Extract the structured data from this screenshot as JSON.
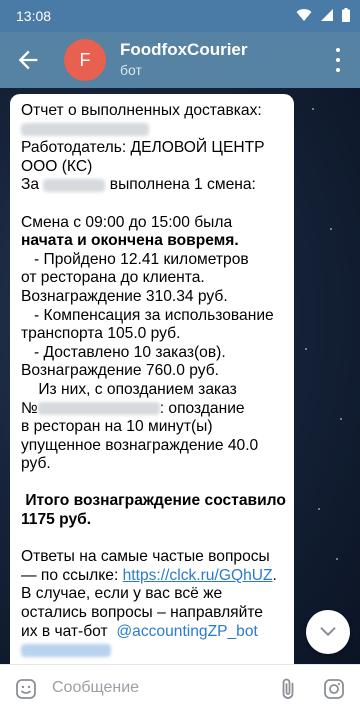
{
  "status_bar": {
    "time": "13:08"
  },
  "header": {
    "title": "FoodfoxCourier",
    "subtitle": "бот",
    "avatar_letter": "F",
    "avatar_color": "#e86150"
  },
  "message": {
    "l1": "Отчет о выполненных доставках:",
    "l3": "Работодатель: ДЕЛОВОЙ ЦЕНТР",
    "l4": "ООО (КС)",
    "l5a": "За",
    "l5b": "выполнена 1 смена:",
    "l7": "Смена с 09:00 до 15:00 была",
    "l8": "начата и окончена вовремя.",
    "l9": "   - Пройдено 12.41 километров",
    "l10": "от ресторана до клиента.",
    "l11": "Вознаграждение 310.34 руб.",
    "l12": "   - Компенсация за использование",
    "l13": "транспорта 105.0 руб.",
    "l14": "   - Доставлено 10 заказ(ов).",
    "l15": "Вознаграждение 760.0 руб.",
    "l16": "    Из них, с опозданием заказ",
    "l17a": "№",
    "l17b": ": опоздание",
    "l18": "в ресторан на 10 минут(ы)",
    "l19": "упущенное вознаграждение 40.0",
    "l20": "руб.",
    "l22": " Итого вознаграждение составило",
    "l23": "1175 руб.",
    "l25": "Ответы на самые частые вопросы",
    "l26a": "— по ссылке: ",
    "l26b": "https://clck.ru/GQhUZ",
    "l26c": ".",
    "l27": "В случае, если у вас всё же",
    "l28": "остались вопросы – направляйте",
    "l29a": "их в чат-бот  ",
    "l29b": "@accountingZP_bot"
  },
  "input": {
    "placeholder": "Сообщение"
  },
  "colors": {
    "header": "#5682a3",
    "status_bar": "#4a7aa6",
    "link": "#2a7bd0"
  },
  "icons": [
    "back-arrow-icon",
    "more-vert-icon",
    "chevron-down-icon",
    "emoji-icon",
    "paperclip-icon",
    "camera-icon",
    "wifi-icon",
    "signal-icon",
    "battery-icon"
  ]
}
